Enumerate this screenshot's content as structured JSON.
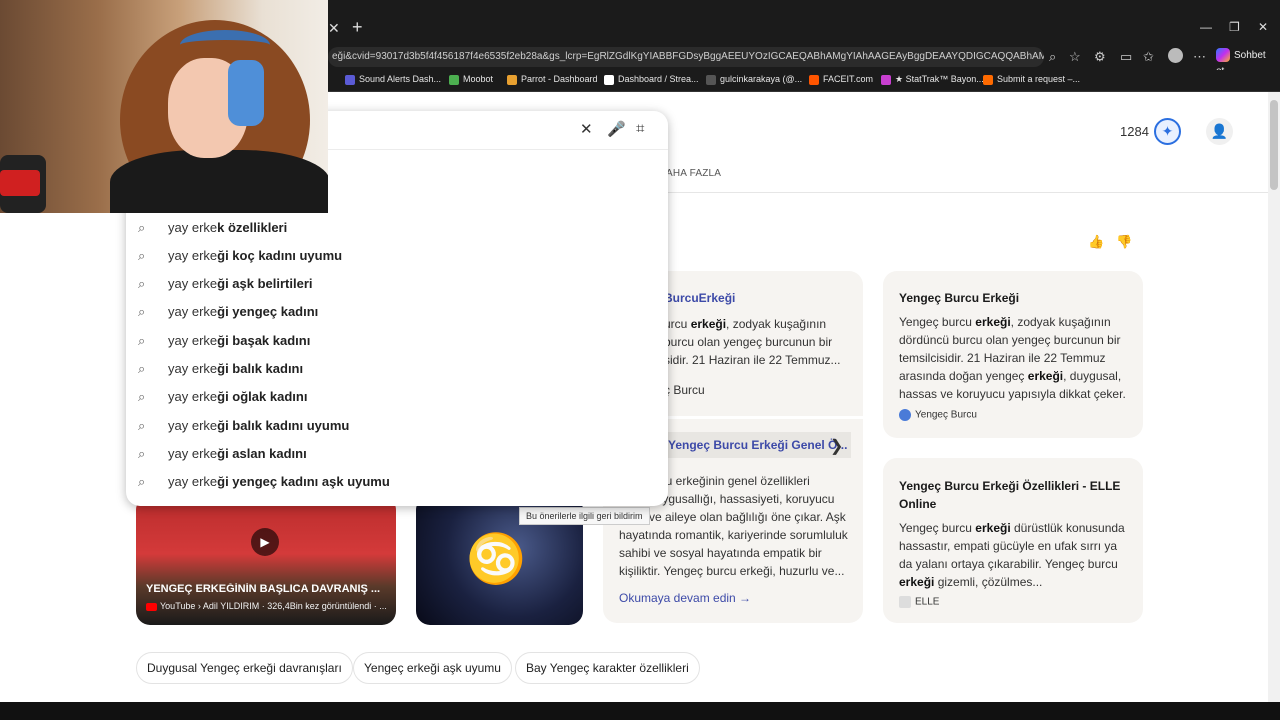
{
  "browser": {
    "url": "eği&cvid=93017d3b5f4f456187f4e6535f2eb28a&gs_lcrp=EgRlZGdlKgYIABBFGDsyBggAEEUYOzIGCAEQABhAMgYIAhAAGEAyBggDEAAYQDIGCAQQABhAMgYIBRAAGEAyBg...",
    "copilot_label": "Sohbet et",
    "bookmarks": [
      {
        "label": "Sound Alerts Dash...",
        "color": "#5b5bd6"
      },
      {
        "label": "Moobot",
        "color": "#4caf50"
      },
      {
        "label": "Parrot - Dashboard",
        "color": "#e8a030"
      },
      {
        "label": "Dashboard / Strea...",
        "color": "#ffffff"
      },
      {
        "label": "gulcinkarakaya (@...",
        "color": "#111111"
      },
      {
        "label": "FACEIT.com",
        "color": "#ff5500"
      },
      {
        "label": "★ StatTrak™ Bayon...",
        "color": "#c83fd0"
      },
      {
        "label": "Submit a request –...",
        "color": "#ff6a00"
      }
    ]
  },
  "header": {
    "points": "1284",
    "more_tab": "AHA FAZLA"
  },
  "suggestions": [
    {
      "prefix": "yay erke",
      "bold": "k özellikleri"
    },
    {
      "prefix": "yay erke",
      "bold": "ği koç kadını uyumu"
    },
    {
      "prefix": "yay erke",
      "bold": "ği aşk belirtileri"
    },
    {
      "prefix": "yay erke",
      "bold": "ği yengeç kadını"
    },
    {
      "prefix": "yay erke",
      "bold": "ği başak kadını"
    },
    {
      "prefix": "yay erke",
      "bold": "ği balık kadını"
    },
    {
      "prefix": "yay erke",
      "bold": "ği oğlak kadını"
    },
    {
      "prefix": "yay erke",
      "bold": "ği balık kadını uyumu"
    },
    {
      "prefix": "yay erke",
      "bold": "ği aslan kadını"
    },
    {
      "prefix": "yay erke",
      "bold": "ği yengeç kadını aşk uyumu"
    }
  ],
  "cards": {
    "card1_title": "BurcuErkeği",
    "card1_text_a": "urcu ",
    "card1_text_b": "erkeği",
    "card1_text_c": ", zodyak kuşağının",
    "card1_line2": "burcu olan yengeç burcunun bir",
    "card1_line3": "sidir. 21 Haziran ile 22 Temmuz...",
    "card1_source": "ç Burcu",
    "card2_title": "Yengeç Burcu Erkeği Genel Ö...",
    "card2_lines": [
      "urcu erkeğinin genel özellikleri",
      "duygusallığı, hassasiyeti, koruyucu",
      "ve aileye olan bağlılığı öne çıkar. Aşk",
      "hayatında romantik, kariyerinde sorumluluk",
      "sahibi ve sosyal hayatında empatik bir",
      "kişiliktir. Yengeç burcu erkeği, huzurlu ve..."
    ],
    "read_more": "Okumaya devam edin →",
    "card3_title": "Yengeç Burcu Erkeği",
    "card3_text": [
      "Yengeç burcu ",
      "erkeği",
      ", zodyak kuşağının"
    ],
    "card3_lines": [
      "dördüncü burcu olan yengeç burcunun bir",
      "temsilcisidir. 21 Haziran ile 22 Temmuz"
    ],
    "card3_line4": [
      "arasında doğan yengeç ",
      "erkeği",
      ", duygusal,"
    ],
    "card3_line5": "hassas ve koruyucu yapısıyla dikkat çeker.",
    "card3_source": "Yengeç Burcu",
    "card4_title_1": "Yengeç Burcu Erkeği Özellikleri - ELLE",
    "card4_title_2": "Online",
    "card4_line1": [
      "Yengeç burcu ",
      "erkeği",
      " dürüstlük konusunda"
    ],
    "card4_line2": "hassastır, empati gücüyle en ufak sırrı ya",
    "card4_line3": "da yalanı ortaya çıkarabilir. Yengeç burcu",
    "card4_line4": [
      "erkeği",
      " gizemli, çözülmes..."
    ],
    "card4_source": "ELLE"
  },
  "video": {
    "title": "YENGEÇ ERKEĞİNİN BAŞLICA DAVRANIŞ ...",
    "meta": "YouTube › Adil YILDIRIM · 326,4Bin kez görüntülendi · ...",
    "tooltip": "Bu önerilerle ilgili geri bildirim"
  },
  "chips": [
    "Duygusal Yengeç erkeği davranışları",
    "Yengeç erkeği aşk uyumu",
    "Bay Yengeç karakter özellikleri"
  ]
}
